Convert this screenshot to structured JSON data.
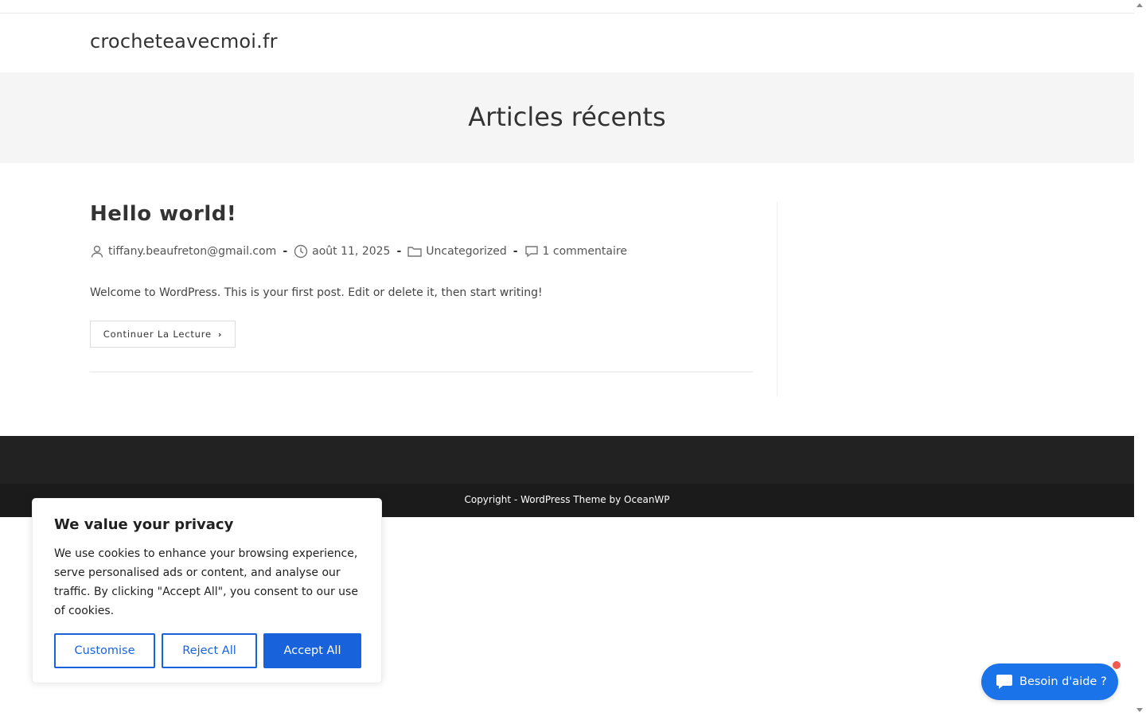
{
  "site": {
    "title": "crocheteavecmoi.fr"
  },
  "page_header": {
    "title": "Articles récents"
  },
  "post": {
    "title": "Hello world!",
    "author": "tiffany.beaufreton@gmail.com",
    "date": "août 11, 2025",
    "category": "Uncategorized",
    "comments": "1 commentaire",
    "excerpt": "Welcome to WordPress. This is your first post. Edit or delete it, then start writing!",
    "read_more": "Continuer La Lecture",
    "separator": "-"
  },
  "footer": {
    "copyright": "Copyright - WordPress Theme by OceanWP"
  },
  "cookie": {
    "title": "We value your privacy",
    "text": "We use cookies to enhance your browsing experience, serve personalised ads or content, and analyse our traffic. By clicking \"Accept All\", you consent to our use of cookies.",
    "customise": "Customise",
    "reject": "Reject All",
    "accept": "Accept All"
  },
  "chat": {
    "label": "Besoin d'aide ?"
  },
  "colors": {
    "accent": "#1863dc",
    "chat": "#1a73e8",
    "footer": "#222222",
    "footer_bottom": "#1b1b1b",
    "page_header_bg": "#f5f5f5",
    "notification_dot": "#f05a4f"
  },
  "icons": [
    "user-icon",
    "clock-icon",
    "folder-icon",
    "comment-icon",
    "chevron-right-icon",
    "chat-bubble-icon"
  ]
}
